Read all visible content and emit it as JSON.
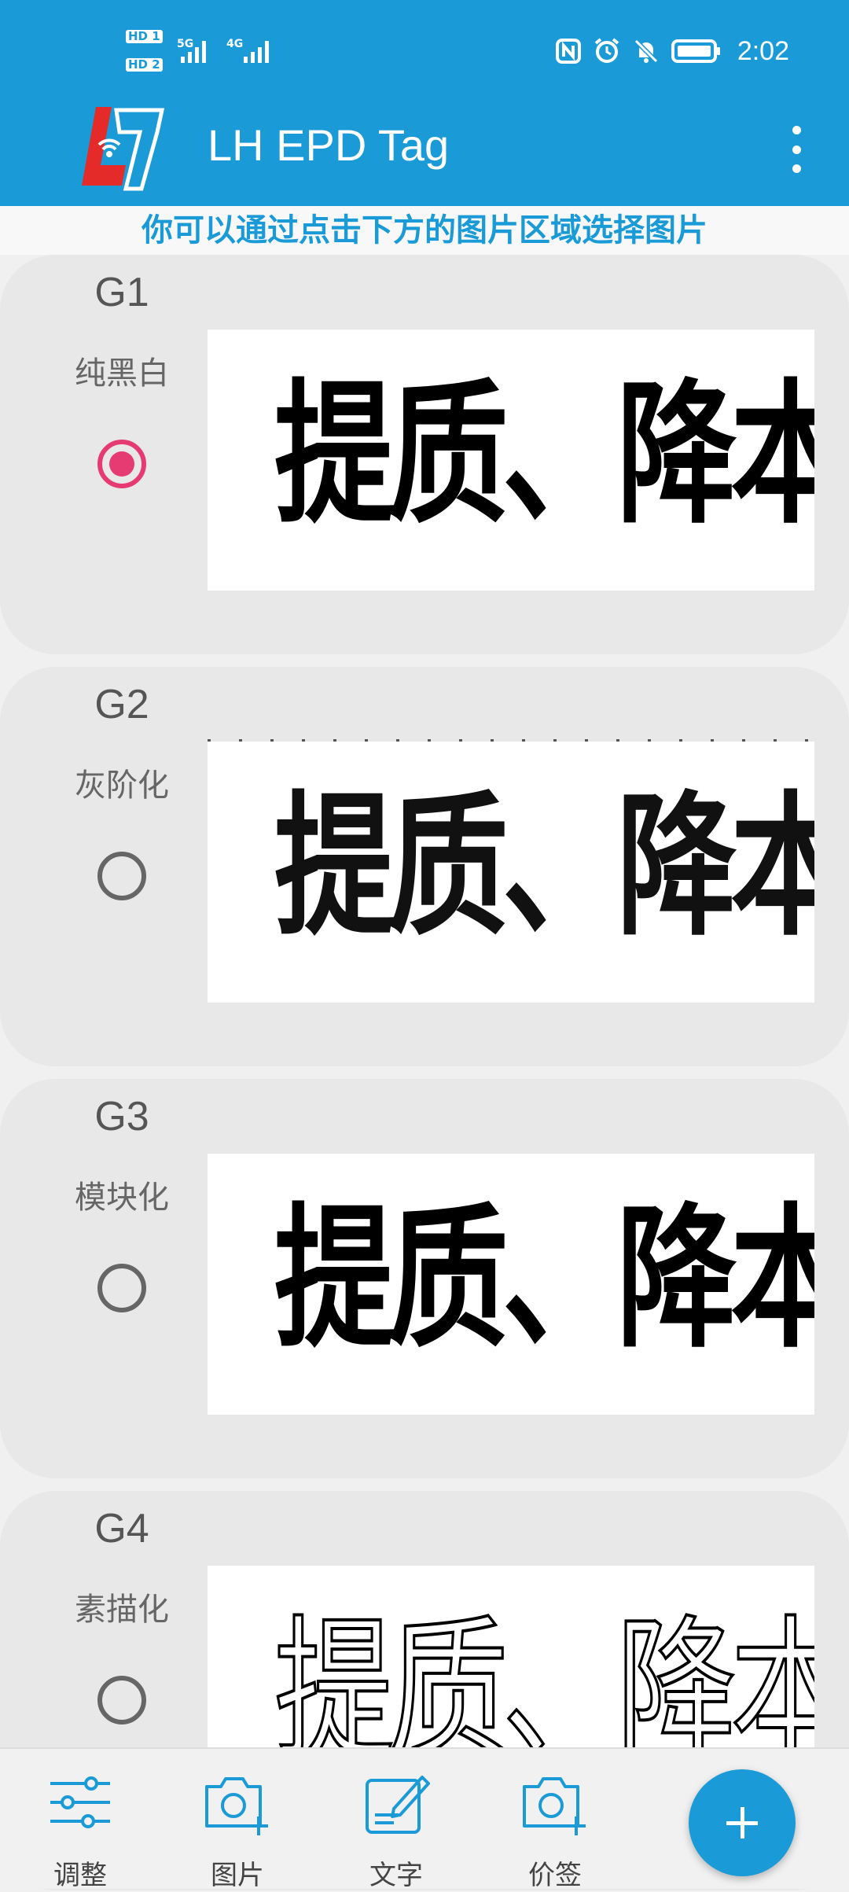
{
  "status_bar": {
    "time": "2:02",
    "sim1": "HD 1",
    "sim2": "HD 2",
    "net1": "5G",
    "net2": "4G"
  },
  "app_bar": {
    "title": "LH EPD Tag"
  },
  "hint": "你可以通过点击下方的图片区域选择图片",
  "options": [
    {
      "title": "G1",
      "mode": "纯黑白",
      "selected": true,
      "preview_text": "提质、降本、增效"
    },
    {
      "title": "G2",
      "mode": "灰阶化",
      "selected": false,
      "preview_text": "提质、降本、增效"
    },
    {
      "title": "G3",
      "mode": "模块化",
      "selected": false,
      "preview_text": "提质、降本、增效"
    },
    {
      "title": "G4",
      "mode": "素描化",
      "selected": false,
      "preview_text": "提质、降本、增效"
    }
  ],
  "bottom_nav": {
    "adjust": "调整",
    "image": "图片",
    "text": "文字",
    "price_tag": "价签"
  },
  "colors": {
    "primary": "#1a9bd7",
    "accent": "#e63a72"
  }
}
